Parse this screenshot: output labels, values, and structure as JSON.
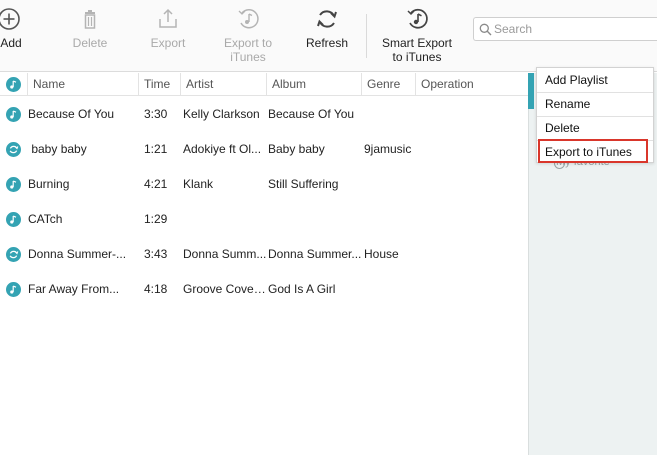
{
  "toolbar": {
    "add": "Add",
    "delete": "Delete",
    "export": "Export",
    "export_to_itunes": [
      "Export to",
      "iTunes"
    ],
    "refresh": "Refresh",
    "smart_export": [
      "Smart Export",
      "to iTunes"
    ],
    "search_placeholder": "Search"
  },
  "table": {
    "columns": [
      "Name",
      "Time",
      "Artist",
      "Album",
      "Genre",
      "Operation"
    ],
    "rows": [
      {
        "icon": "music-note-icon",
        "name": "Because Of You",
        "time": "3:30",
        "artist": "Kelly Clarkson",
        "album": "Because Of You",
        "genre": "",
        "operation": ""
      },
      {
        "icon": "sync-icon",
        "name": " baby baby",
        "time": "1:21",
        "artist": "Adokiye ft Ol...",
        "album": "Baby baby",
        "genre": "9jamusic",
        "operation": ""
      },
      {
        "icon": "music-note-icon",
        "name": "Burning",
        "time": "4:21",
        "artist": "Klank",
        "album": "Still Suffering",
        "genre": "",
        "operation": ""
      },
      {
        "icon": "music-note-icon",
        "name": "CATch",
        "time": "1:29",
        "artist": "",
        "album": "",
        "genre": "",
        "operation": ""
      },
      {
        "icon": "sync-icon",
        "name": "Donna Summer-...",
        "time": "3:43",
        "artist": "Donna Summ...",
        "album": "Donna Summer...",
        "genre": "House",
        "operation": ""
      },
      {
        "icon": "music-note-icon",
        "name": "Far Away From...",
        "time": "4:18",
        "artist": "Groove Cover...",
        "album": "God Is A Girl",
        "genre": "",
        "operation": ""
      }
    ]
  },
  "sidebar": {
    "partial_item": "My favorite"
  },
  "context_menu": {
    "items": [
      "Add Playlist",
      "Rename",
      "Delete",
      "Export to iTunes"
    ],
    "highlighted": "Export to iTunes"
  },
  "colors": {
    "accent": "#34a3b3",
    "highlight_box": "#d9362b",
    "disabled_text": "#a9a9a9"
  }
}
